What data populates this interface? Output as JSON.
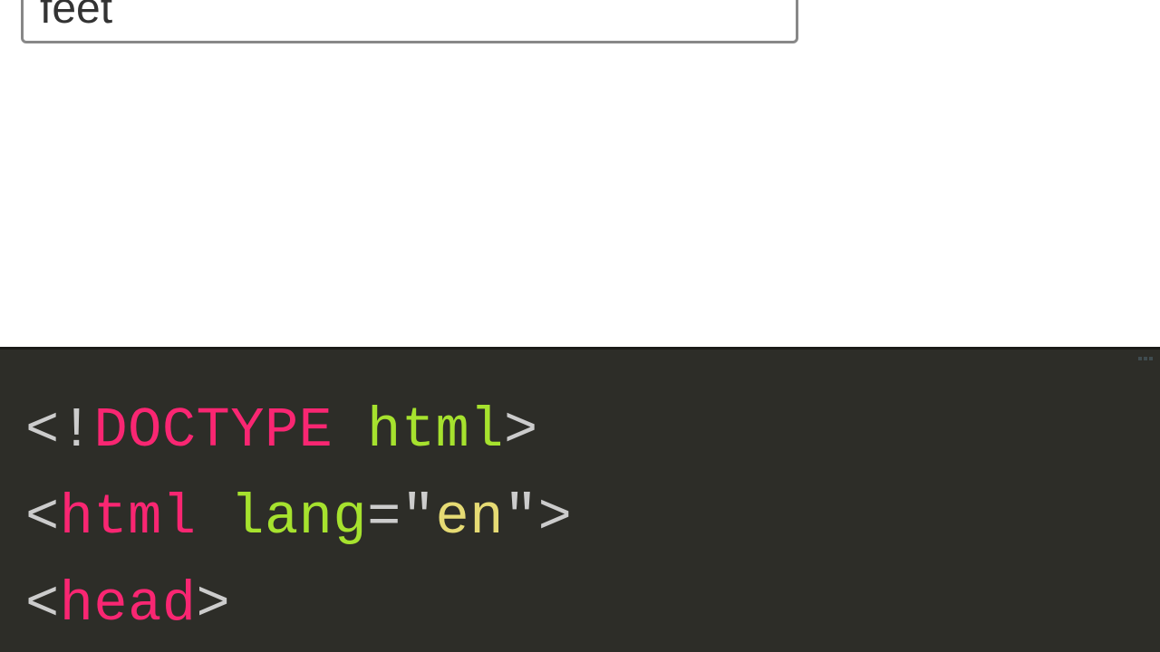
{
  "input": {
    "value": "feet"
  },
  "code": {
    "line1": {
      "angle_open": "<",
      "excl": "!",
      "doctype": "DOCTYPE",
      "space": " ",
      "html": "html",
      "angle_close": ">"
    },
    "line2": {
      "angle_open": "<",
      "tag": "html",
      "space": " ",
      "attr": "lang",
      "equals": "=",
      "quote_open": "\"",
      "string": "en",
      "quote_close": "\"",
      "angle_close": ">"
    },
    "line3": {
      "angle_open": "<",
      "tag": "head",
      "angle_close": ">"
    }
  }
}
